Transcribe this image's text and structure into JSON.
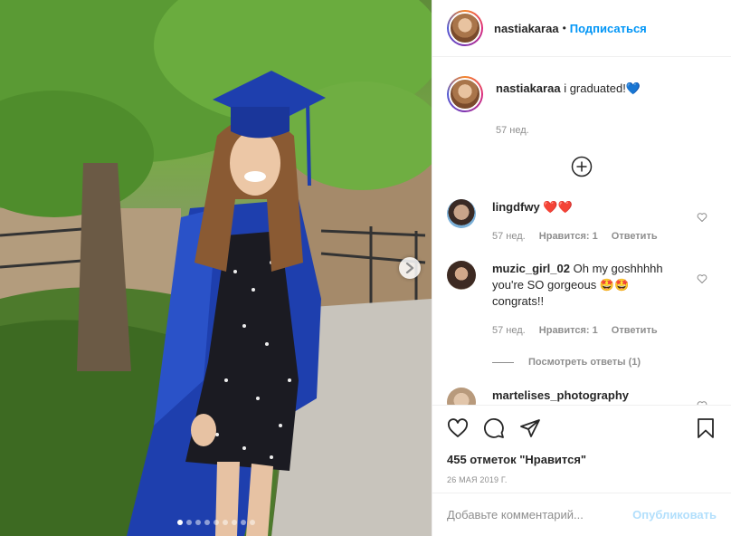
{
  "header": {
    "username": "nastiakaraa",
    "separator": "•",
    "follow_label": "Подписаться"
  },
  "caption": {
    "username": "nastiakaraa",
    "text": "i graduated!",
    "emoji": "💙",
    "time": "57 нед."
  },
  "comments": [
    {
      "username": "lingdfwy",
      "text": "",
      "emoji": "❤️❤️",
      "time": "57 нед.",
      "likes": "Нравится: 1",
      "reply_label": "Ответить"
    },
    {
      "username": "muzic_girl_02",
      "text": "Oh my goshhhhh you're SO gorgeous",
      "emoji": "🤩🤩",
      "text_after": "congrats!!",
      "time": "57 нед.",
      "likes": "Нравится: 1",
      "reply_label": "Ответить",
      "view_replies": "Посмотреть ответы (1)"
    },
    {
      "username": "martelises_photography"
    }
  ],
  "actions": {
    "like_icon": "heart-icon",
    "comment_icon": "comment-icon",
    "share_icon": "paper-plane-icon",
    "save_icon": "bookmark-icon",
    "likes_text": "455 отметок \"Нравится\"",
    "date": "26 МАЯ 2019 Г."
  },
  "add_comment": {
    "placeholder": "Добавьте комментарий...",
    "post_label": "Опубликовать"
  },
  "carousel": {
    "total": 9,
    "active": 1
  },
  "colors": {
    "link": "#0095f6",
    "muted": "#8e8e8e",
    "heart_red": "#ed4956",
    "post_disabled": "#b2dffc"
  }
}
